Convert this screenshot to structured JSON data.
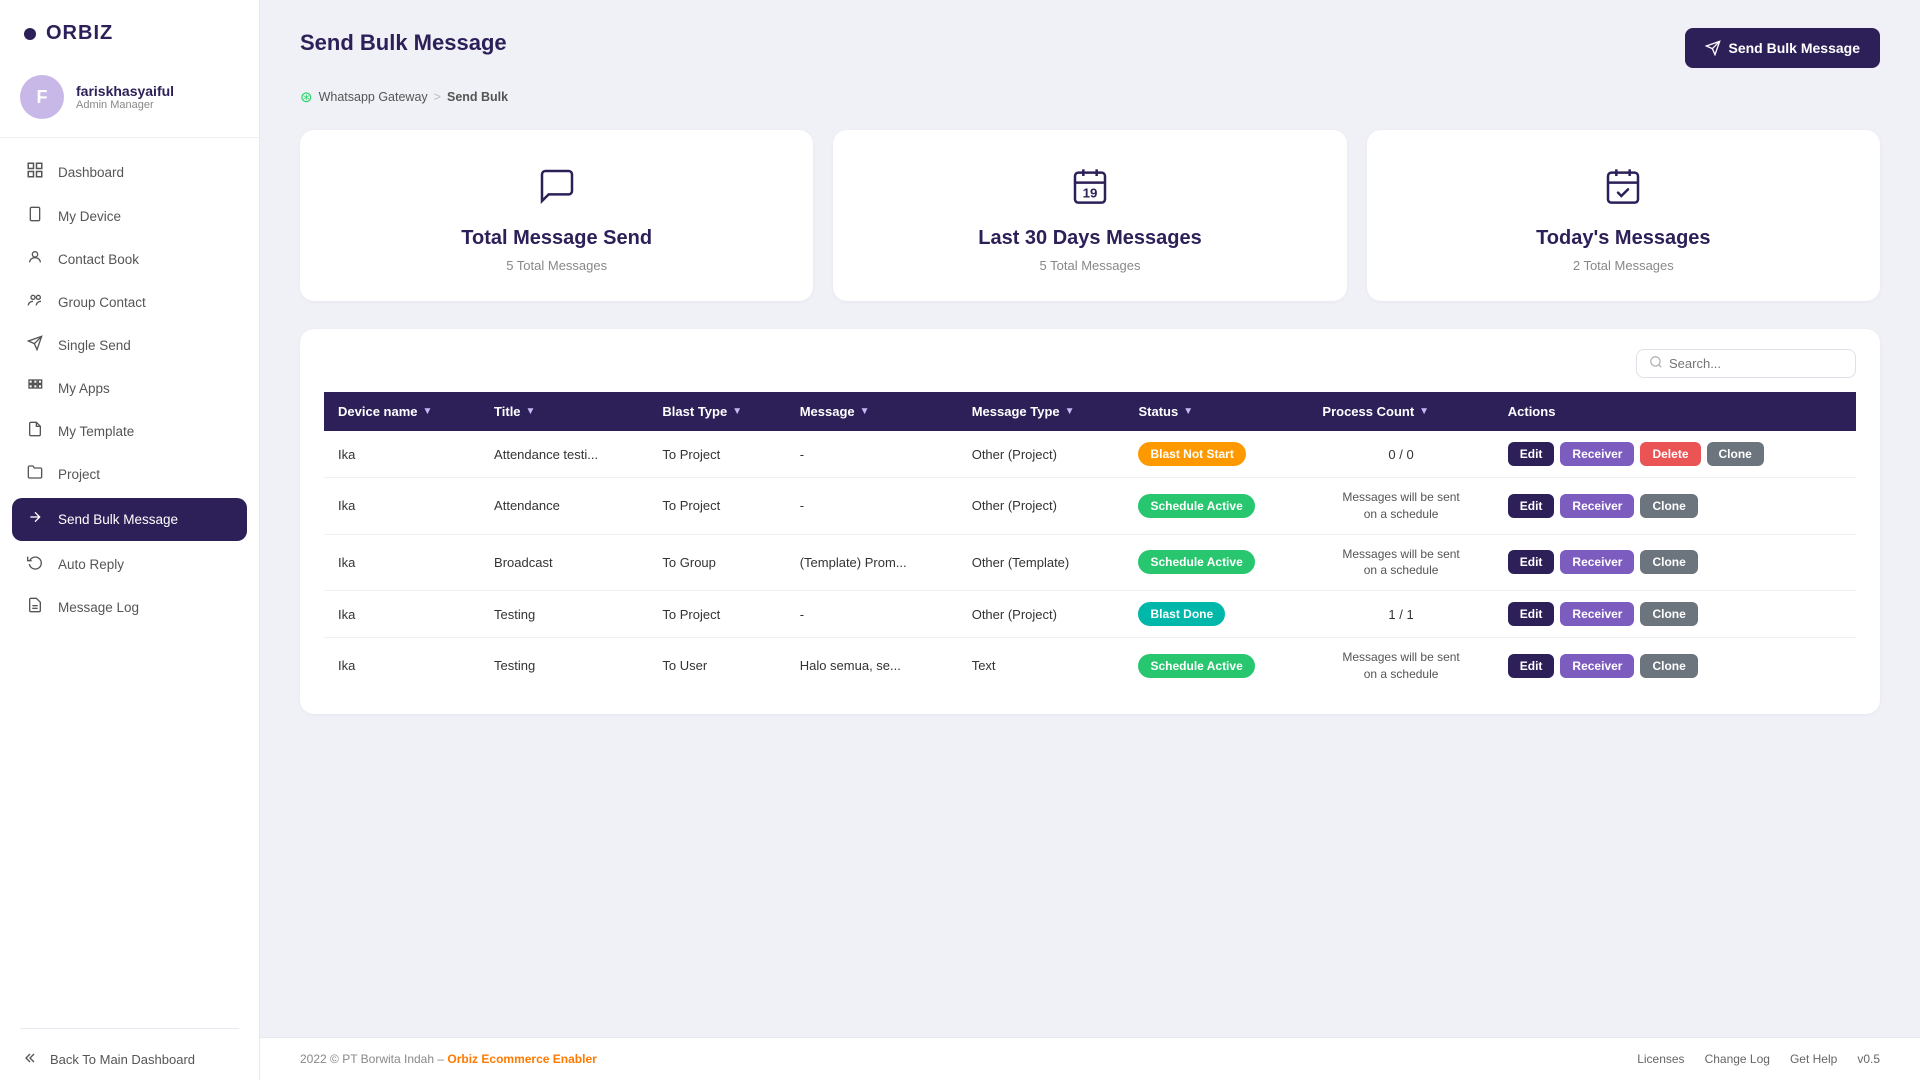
{
  "app": {
    "logo": "ORBIZ",
    "logo_dot": "●"
  },
  "sidebar": {
    "user": {
      "name": "fariskhasyaiful",
      "role": "Admin Manager",
      "avatar_initials": "F"
    },
    "nav_items": [
      {
        "id": "dashboard",
        "label": "Dashboard",
        "icon": "📊"
      },
      {
        "id": "my-device",
        "label": "My Device",
        "icon": "📱"
      },
      {
        "id": "contact-book",
        "label": "Contact Book",
        "icon": "👤"
      },
      {
        "id": "group-contact",
        "label": "Group Contact",
        "icon": "👥"
      },
      {
        "id": "single-send",
        "label": "Single Send",
        "icon": "📨"
      },
      {
        "id": "my-apps",
        "label": "My Apps",
        "icon": "🧩"
      },
      {
        "id": "my-template",
        "label": "My Template",
        "icon": "📄"
      },
      {
        "id": "project",
        "label": "Project",
        "icon": "📁"
      },
      {
        "id": "send-bulk-message",
        "label": "Send Bulk Message",
        "icon": "🚀",
        "active": true
      },
      {
        "id": "auto-reply",
        "label": "Auto Reply",
        "icon": "🔄"
      },
      {
        "id": "message-log",
        "label": "Message Log",
        "icon": "📋"
      }
    ],
    "back_label": "Back To Main Dashboard"
  },
  "page": {
    "title": "Send Bulk Message",
    "breadcrumb": [
      {
        "label": "Whatsapp Gateway",
        "link": true
      },
      {
        "label": "Send Bulk",
        "active": true
      }
    ]
  },
  "send_bulk_button": "Send Bulk Message",
  "stats": [
    {
      "id": "total",
      "icon": "💬",
      "title": "Total Message Send",
      "subtitle": "5 Total Messages"
    },
    {
      "id": "last30",
      "icon": "🗓",
      "title": "Last 30 Days Messages",
      "subtitle": "5 Total Messages"
    },
    {
      "id": "today",
      "icon": "✅",
      "title": "Today's Messages",
      "subtitle": "2 Total Messages"
    }
  ],
  "search": {
    "placeholder": "Search..."
  },
  "table": {
    "columns": [
      {
        "id": "device",
        "label": "Device name"
      },
      {
        "id": "title",
        "label": "Title"
      },
      {
        "id": "blast_type",
        "label": "Blast Type"
      },
      {
        "id": "message",
        "label": "Message"
      },
      {
        "id": "message_type",
        "label": "Message Type"
      },
      {
        "id": "status",
        "label": "Status"
      },
      {
        "id": "process_count",
        "label": "Process Count"
      },
      {
        "id": "actions",
        "label": "Actions"
      }
    ],
    "rows": [
      {
        "device": "Ika",
        "title": "Attendance testi...",
        "blast_type": "To Project",
        "message": "-",
        "message_type": "Other (Project)",
        "status": "Blast Not Start",
        "status_class": "badge-orange",
        "process_count": "0 / 0",
        "has_delete": true
      },
      {
        "device": "Ika",
        "title": "Attendance",
        "blast_type": "To Project",
        "message": "-",
        "message_type": "Other (Project)",
        "status": "Schedule Active",
        "status_class": "badge-green",
        "process_count": "Messages will be sent\non a schedule",
        "process_center": true,
        "has_delete": false
      },
      {
        "device": "Ika",
        "title": "Broadcast",
        "blast_type": "To Group",
        "message": "(Template) Prom...",
        "message_type": "Other (Template)",
        "status": "Schedule Active",
        "status_class": "badge-green",
        "process_count": "Messages will be sent\non a schedule",
        "process_center": true,
        "has_delete": false
      },
      {
        "device": "Ika",
        "title": "Testing",
        "blast_type": "To Project",
        "message": "-",
        "message_type": "Other (Project)",
        "status": "Blast Done",
        "status_class": "badge-teal",
        "process_count": "1 / 1",
        "has_delete": false
      },
      {
        "device": "Ika",
        "title": "Testing",
        "blast_type": "To User",
        "message": "Halo semua, se...",
        "message_type": "Text",
        "status": "Schedule Active",
        "status_class": "badge-green",
        "process_count": "Messages will be sent\non a schedule",
        "process_center": true,
        "has_delete": false
      }
    ]
  },
  "actions": {
    "edit": "Edit",
    "receiver": "Receiver",
    "delete": "Delete",
    "clone": "Clone"
  },
  "footer": {
    "left": "2022 © PT Borwita Indah –",
    "brand_link": "Orbiz Ecommerce Enabler",
    "links": [
      "Licenses",
      "Change Log",
      "Get Help"
    ],
    "version": "v0.5"
  }
}
